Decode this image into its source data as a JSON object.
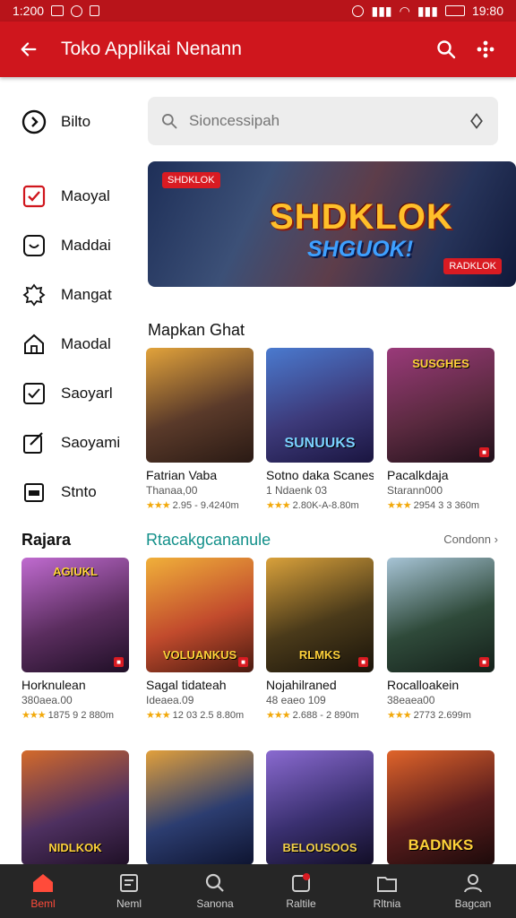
{
  "status_bar": {
    "time_left": "1:200",
    "time_right": "19:80"
  },
  "app_bar": {
    "title": "Toko Applikai Nenann"
  },
  "search": {
    "placeholder": "Sioncessipah"
  },
  "sidebar": {
    "items": [
      {
        "label": "Bilto",
        "icon": "clock-icon"
      },
      {
        "label": "Maoyal",
        "icon": "checkbox-icon"
      },
      {
        "label": "Maddai",
        "icon": "square-face-icon"
      },
      {
        "label": "Mangat",
        "icon": "puzzle-icon"
      },
      {
        "label": "Maodal",
        "icon": "house-icon"
      },
      {
        "label": "Saoyarl",
        "icon": "check-square-icon"
      },
      {
        "label": "Saoyami",
        "icon": "edit-icon"
      },
      {
        "label": "Stnto",
        "icon": "calendar-icon"
      }
    ]
  },
  "banner": {
    "tag": "SHDKLOK",
    "title": "SHDKLOK",
    "subtitle": "SHGUOK!",
    "badge": "RADKLOK"
  },
  "section1": {
    "title": "Mapkan Ghat",
    "cards": [
      {
        "name": "Fatrian Vaba",
        "sub": "Thanaa,00",
        "rating": "2.95 - 9.4240m",
        "thumb_text": "",
        "bg": "#5a3a2a"
      },
      {
        "name": "Sotno daka Scanes",
        "sub": "1 Ndaenk 03",
        "rating": "2.80K-A-8.80m",
        "thumb_text": "SUNUUKS",
        "bg": "#3d3a7a"
      },
      {
        "name": "Pacalkdaja",
        "sub": "Starann000",
        "rating": "2954 3 3 360m",
        "thumb_text": "SUSGHES",
        "bg": "#5b2a40"
      }
    ]
  },
  "section2": {
    "left_title": "Rajara",
    "title": "Rtacakgcananule",
    "see_all": "Condonn",
    "cards": [
      {
        "name": "Horknulean",
        "sub": "380aea.00",
        "rating": "1875 9 2 880m",
        "thumb_text": "AGIUKL",
        "bg": "#5a2d5e"
      },
      {
        "name": "Sagal tidateah",
        "sub": "Ideaea.09",
        "rating": "12 03 2.5 8.80m",
        "thumb_text": "VOLUANKUS",
        "bg": "#c24b2d"
      },
      {
        "name": "Nojahilraned",
        "sub": "48 eaeo 109",
        "rating": "2.688 - 2 890m",
        "thumb_text": "RLMKS",
        "bg": "#4a3a1a"
      },
      {
        "name": "Rocalloakein",
        "sub": "38eaea00",
        "rating": "2773 2.699m",
        "thumb_text": "",
        "bg": "#2f4a3a"
      },
      {
        "name": "",
        "sub": "",
        "rating": "",
        "thumb_text": "NIDLKOK",
        "bg": "#4e3060"
      },
      {
        "name": "",
        "sub": "",
        "rating": "",
        "thumb_text": "",
        "bg": "#2c3d70"
      },
      {
        "name": "",
        "sub": "",
        "rating": "",
        "thumb_text": "BELOUSOOS",
        "bg": "#3a3070"
      },
      {
        "name": "",
        "sub": "",
        "rating": "",
        "thumb_text": "BADNKS",
        "bg": "#5a1d1d"
      }
    ]
  },
  "bottom_nav": {
    "items": [
      {
        "label": "Beml",
        "icon": "home-icon"
      },
      {
        "label": "Neml",
        "icon": "list-icon"
      },
      {
        "label": "Sanona",
        "icon": "search-icon"
      },
      {
        "label": "Raltile",
        "icon": "notification-icon"
      },
      {
        "label": "Rltnia",
        "icon": "folder-icon"
      },
      {
        "label": "Bagcan",
        "icon": "profile-icon"
      }
    ]
  },
  "colors": {
    "accent": "#cf161d",
    "nav_bg": "#262626",
    "active": "#ff4b3a",
    "link": "#13908a"
  }
}
